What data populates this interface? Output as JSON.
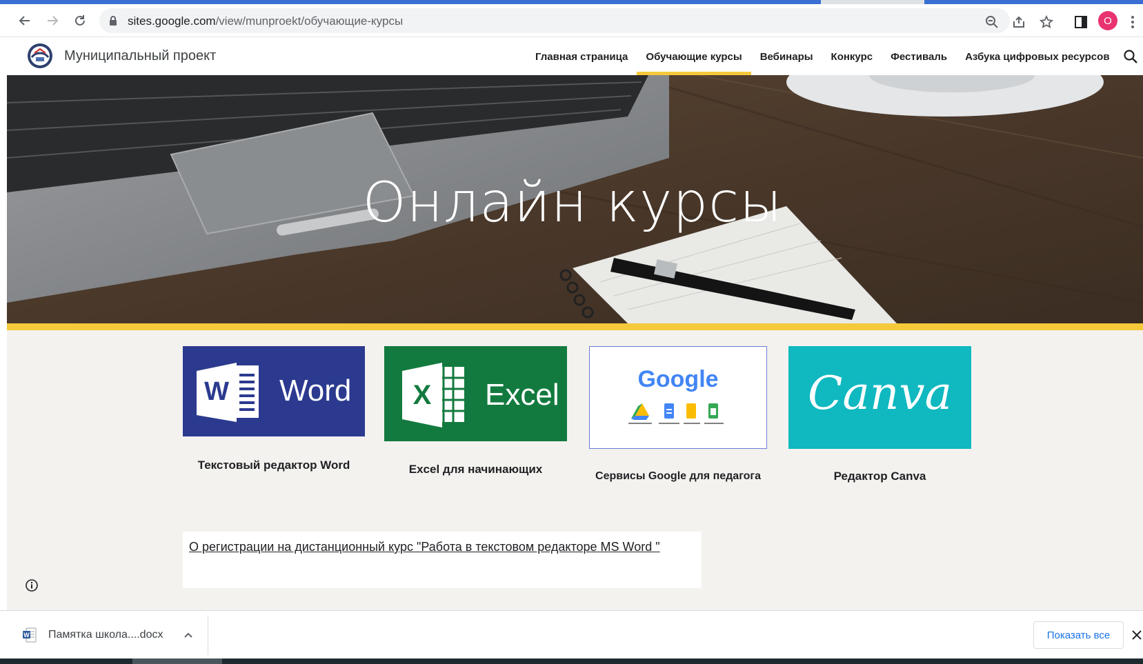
{
  "browser": {
    "url_domain": "sites.google.com",
    "url_path": "/view/munproekt/обучающие-курсы",
    "profile_initial": "O",
    "icons": [
      "back-arrow-icon",
      "forward-arrow-icon",
      "reload-icon",
      "lock-icon",
      "zoom-icon",
      "share-icon",
      "bookmark-star-icon",
      "side-panel-icon",
      "kebab-menu-icon"
    ]
  },
  "site": {
    "title": "Муниципальный проект",
    "nav": [
      {
        "label": "Главная страница",
        "active": false
      },
      {
        "label": "Обучающие курсы",
        "active": true
      },
      {
        "label": "Вебинары",
        "active": false
      },
      {
        "label": "Конкурс",
        "active": false
      },
      {
        "label": "Фестиваль",
        "active": false
      },
      {
        "label": "Азбука цифровых ресурсов",
        "active": false
      }
    ],
    "accent_color": "#f6c93b"
  },
  "hero": {
    "title": "Онлайн курсы"
  },
  "courses": [
    {
      "tile_text": "Word",
      "label": "Текстовый редактор Word",
      "color": "#2b3a8f"
    },
    {
      "tile_text": "Excel",
      "label": "Excel для начинающих",
      "color": "#137a3f"
    },
    {
      "tile_text": "Google",
      "label": "Сервисы Google  для педагога",
      "color": "#ffffff"
    },
    {
      "tile_text": "Canva",
      "label": "Редактор Canva",
      "color": "#10b8c0"
    }
  ],
  "registration_link": "О регистрации на  дистанционный курс \"Работа в текстовом редакторе MS Word \"",
  "downloads": {
    "file_name": "Памятка школа....docx",
    "show_all_label": "Показать все"
  }
}
